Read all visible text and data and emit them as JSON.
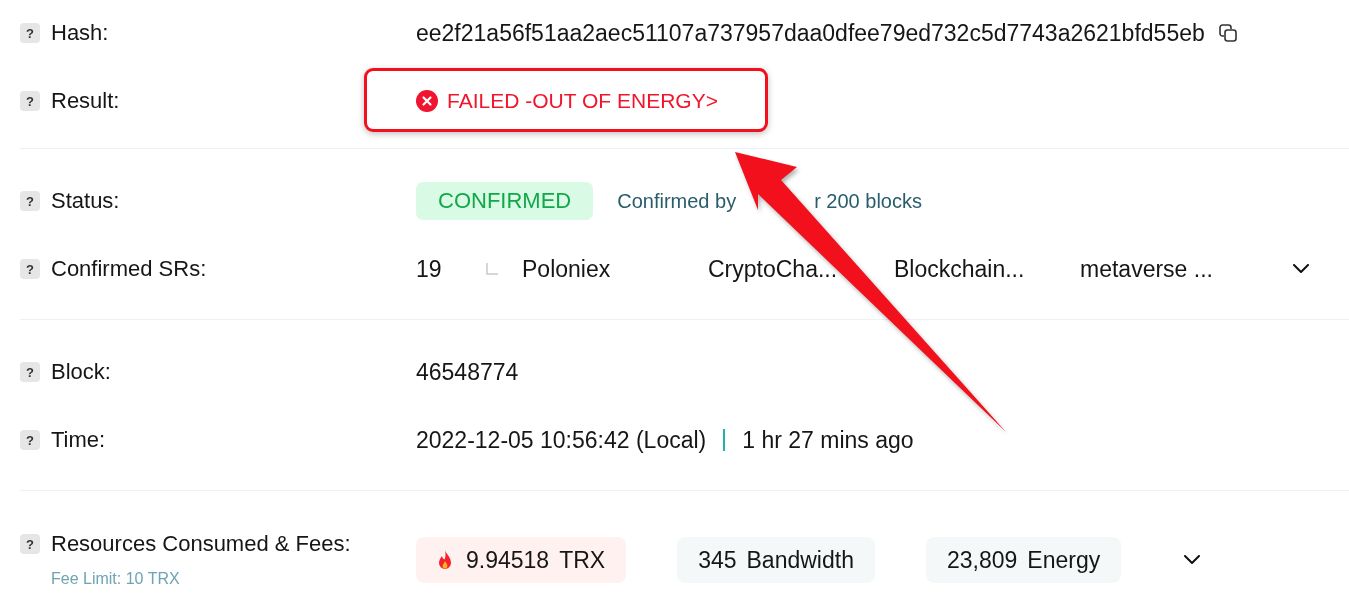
{
  "sections": [
    {
      "fields": [
        {
          "kind": "hash",
          "help": "?",
          "label": "Hash:",
          "value": "ee2f21a56f51aa2aec51107a737957daa0dfee79ed732c5d7743a2621bfd55eb"
        },
        {
          "kind": "result",
          "help": "?",
          "label": "Result:",
          "value": "FAILED -OUT OF ENERGY>",
          "highlighted": true
        }
      ]
    },
    {
      "fields": [
        {
          "kind": "status",
          "help": "?",
          "label": "Status:",
          "badge": "CONFIRMED",
          "note_fragments": [
            "Confirmed by",
            "r 200 blocks"
          ]
        },
        {
          "kind": "witnesses",
          "help": "?",
          "label": "Confirmed SRs:",
          "count": "19",
          "items": [
            "Poloniex",
            "CryptoCha...",
            "Blockchain...",
            "metaverse ..."
          ],
          "expanded": false
        }
      ]
    },
    {
      "fields": [
        {
          "kind": "text",
          "help": "?",
          "label": "Block:",
          "value": "46548774"
        },
        {
          "kind": "time",
          "help": "?",
          "label": "Time:",
          "value": "2022-12-05 10:56:42 (Local)",
          "age": "1 hr 27 mins ago"
        }
      ]
    },
    {
      "fields": [
        {
          "kind": "resources",
          "help": "?",
          "label": "Resources Consumed & Fees:",
          "sublabel": "Fee Limit: 10 TRX",
          "chips": [
            {
              "kind": "burn",
              "amount": "9.94518",
              "unit": "TRX"
            },
            {
              "kind": "plain",
              "amount": "345",
              "unit": "Bandwidth"
            },
            {
              "kind": "plain",
              "amount": "23,809",
              "unit": "Energy"
            }
          ],
          "expanded": false
        }
      ]
    }
  ]
}
